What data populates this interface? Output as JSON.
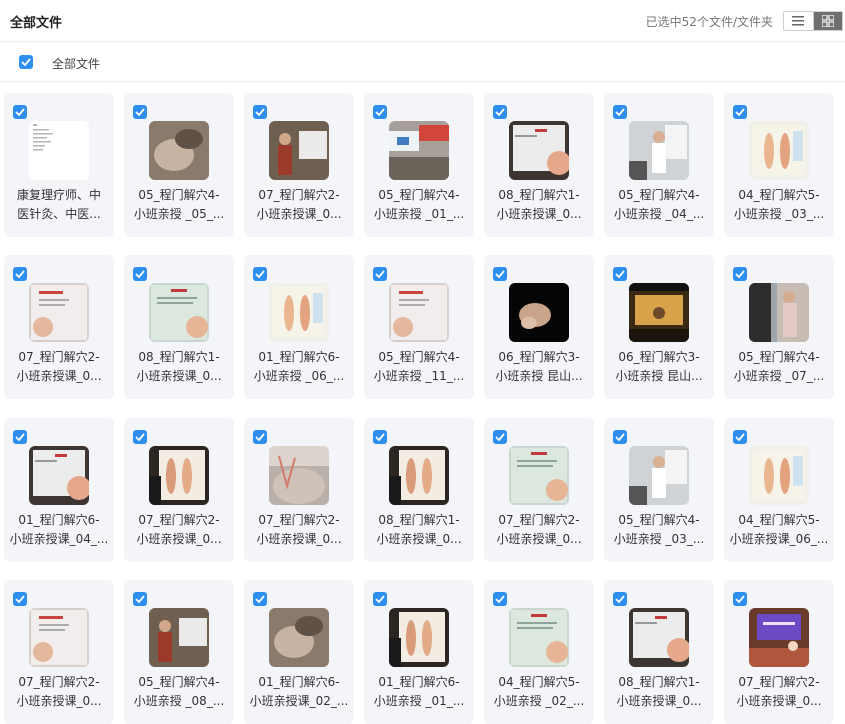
{
  "header": {
    "title": "全部文件",
    "status": "已选中52个文件/文件夹"
  },
  "subbar": {
    "label": "全部文件"
  },
  "files": [
    {
      "line1": "康复理疗师、中",
      "line2": "医针灸、中医...",
      "thumb": "document"
    },
    {
      "line1": "05_程门解穴4-",
      "line2": "小班亲授 _05_...",
      "thumb": "hands"
    },
    {
      "line1": "07_程门解穴2-",
      "line2": "小班亲授课_0...",
      "thumb": "lecture"
    },
    {
      "line1": "05_程门解穴4-",
      "line2": "小班亲授 _01_...",
      "thumb": "classroom"
    },
    {
      "line1": "08_程门解穴1-",
      "line2": "小班亲授课_0...",
      "thumb": "slide-dark"
    },
    {
      "line1": "05_程门解穴4-",
      "line2": "小班亲授 _04_...",
      "thumb": "speaker"
    },
    {
      "line1": "04_程门解穴5-",
      "line2": "小班亲授 _03_...",
      "thumb": "anatomy"
    },
    {
      "line1": "07_程门解穴2-",
      "line2": "小班亲授课_0...",
      "thumb": "slide"
    },
    {
      "line1": "08_程门解穴1-",
      "line2": "小班亲授课_0...",
      "thumb": "slide-green"
    },
    {
      "line1": "01_程门解穴6-",
      "line2": "小班亲授 _06_...",
      "thumb": "anatomy"
    },
    {
      "line1": "05_程门解穴4-",
      "line2": "小班亲授 _11_...",
      "thumb": "slide"
    },
    {
      "line1": "06_程门解穴3-",
      "line2": "小班亲授 昆山...",
      "thumb": "dark-hand"
    },
    {
      "line1": "06_程门解穴3-",
      "line2": "小班亲授 昆山...",
      "thumb": "stage"
    },
    {
      "line1": "05_程门解穴4-",
      "line2": "小班亲授 _07_...",
      "thumb": "people"
    },
    {
      "line1": "01_程门解穴6-",
      "line2": "小班亲授课_04_...",
      "thumb": "slide-dark"
    },
    {
      "line1": "07_程门解穴2-",
      "line2": "小班亲授课_0...",
      "thumb": "anatomy-dark"
    },
    {
      "line1": "07_程门解穴2-",
      "line2": "小班亲授课_0...",
      "thumb": "skin"
    },
    {
      "line1": "08_程门解穴1-",
      "line2": "小班亲授课_0...",
      "thumb": "anatomy-dark"
    },
    {
      "line1": "07_程门解穴2-",
      "line2": "小班亲授课_0...",
      "thumb": "slide-green"
    },
    {
      "line1": "05_程门解穴4-",
      "line2": "小班亲授 _03_...",
      "thumb": "speaker"
    },
    {
      "line1": "04_程门解穴5-",
      "line2": "小班亲授课_06_...",
      "thumb": "anatomy"
    },
    {
      "line1": "07_程门解穴2-",
      "line2": "小班亲授课_0...",
      "thumb": "slide"
    },
    {
      "line1": "05_程门解穴4-",
      "line2": "小班亲授 _08_...",
      "thumb": "lecture"
    },
    {
      "line1": "01_程门解穴6-",
      "line2": "小班亲授课_02_...",
      "thumb": "hands"
    },
    {
      "line1": "01_程门解穴6-",
      "line2": "小班亲授 _01_...",
      "thumb": "anatomy-dark"
    },
    {
      "line1": "04_程门解穴5-",
      "line2": "小班亲授 _02_...",
      "thumb": "slide-green"
    },
    {
      "line1": "08_程门解穴1-",
      "line2": "小班亲授课_0...",
      "thumb": "slide-dark"
    },
    {
      "line1": "07_程门解穴2-",
      "line2": "小班亲授课_0...",
      "thumb": "banner"
    }
  ],
  "colors": {
    "accent": "#2f8ff0",
    "tile_bg": "#f3f5f9",
    "toggle_active": "#6f6f6f"
  }
}
